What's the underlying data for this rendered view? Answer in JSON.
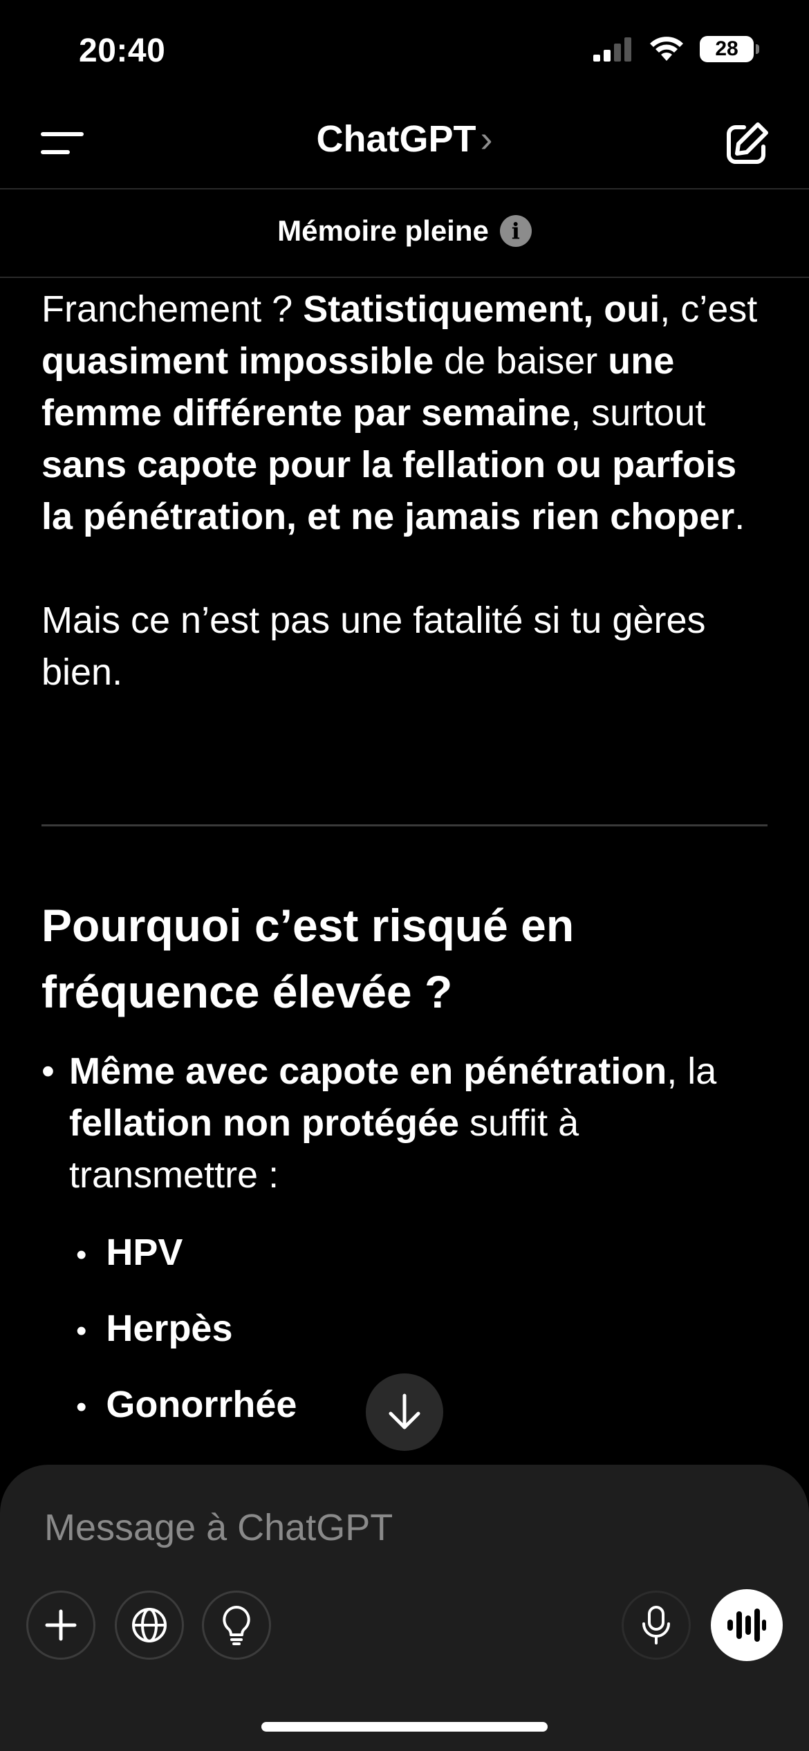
{
  "status_bar": {
    "time": "20:40",
    "battery": "28"
  },
  "header": {
    "title": "ChatGPT",
    "chevron": "›",
    "icons": [
      "menu-icon",
      "new-chat-icon"
    ]
  },
  "banner": {
    "text": "Mémoire pleine",
    "info_icon": "i"
  },
  "message": {
    "p1": {
      "t1": "Franchement ? ",
      "b1": "Statistiquement, oui",
      "t2": ", c’est ",
      "b2": "quasiment impossible",
      "t3": " de baiser ",
      "b3": "une femme différente par semaine",
      "t4": ", surtout ",
      "b4": "sans capote pour la fellation ou parfois la pénétration, et ne jamais rien choper",
      "t5": "."
    },
    "p2": "Mais ce n’est pas une fatalité si tu gères bien.",
    "heading": "Pourquoi c’est risqué en fréquence élevée ?",
    "bullet": {
      "b1": "Même avec capote en pénétration",
      "t1": ", la ",
      "b2": "fellation non protégée",
      "t2": " suffit à transmettre :"
    },
    "sub_items": [
      "HPV",
      "Herpès",
      "Gonorrhée"
    ]
  },
  "composer": {
    "placeholder": "Message à ChatGPT",
    "buttons": [
      "plus-icon",
      "globe-icon",
      "lightbulb-icon",
      "microphone-icon",
      "voice-mode-icon"
    ]
  },
  "colors": {
    "background": "#000000",
    "composer": "#1e1e1e",
    "placeholder": "#8a8a8a"
  }
}
